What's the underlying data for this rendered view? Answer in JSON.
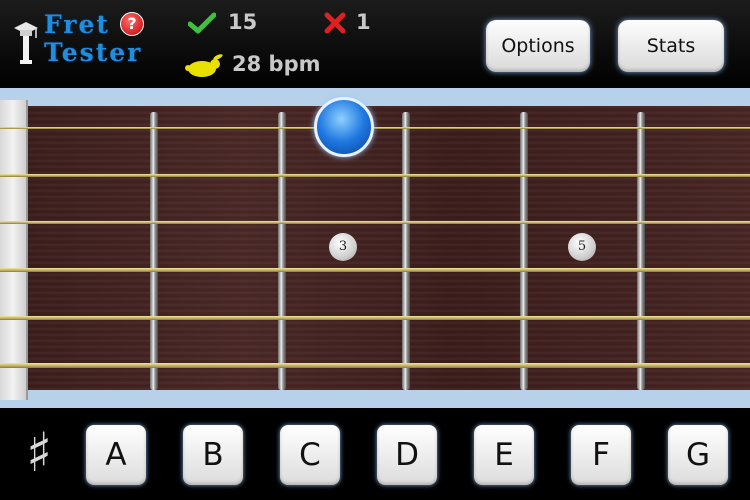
{
  "app": {
    "logo_line1": "Fret",
    "logo_line2": "Tester",
    "help_label": "?",
    "icons": {
      "cap": "graduation-cap-icon",
      "help": "help-icon",
      "correct": "checkmark-icon",
      "wrong": "x-mark-icon",
      "tempo": "rabbit-icon",
      "sharp": "sharp-icon"
    }
  },
  "stats": {
    "correct": "15",
    "wrong": "1",
    "tempo": "28 bpm"
  },
  "buttons": {
    "options": "Options",
    "stats": "Stats"
  },
  "fretboard": {
    "markers": [
      "3",
      "5"
    ]
  },
  "notes": {
    "accidental": "♯",
    "keys": [
      "A",
      "B",
      "C",
      "D",
      "E",
      "F",
      "G"
    ]
  },
  "colors": {
    "accent_blue": "#1e8fe0",
    "correct_green": "#3cc23c",
    "wrong_red": "#e02020",
    "tempo_yellow": "#e8e000"
  }
}
